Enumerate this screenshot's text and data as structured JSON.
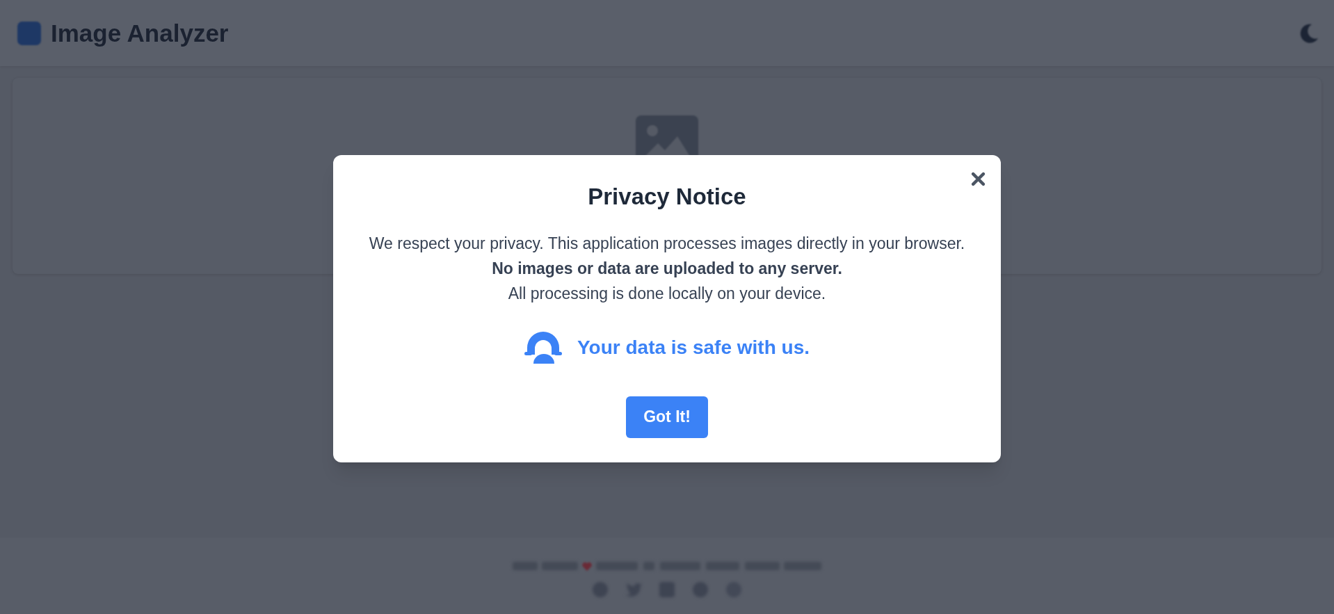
{
  "header": {
    "title": "Image Analyzer"
  },
  "modal": {
    "title": "Privacy Notice",
    "body": "We respect your privacy. This application processes images directly in your browser.\n**No images or data are uploaded to any server.**\nAll processing is done locally on your device.",
    "safe_note": "Your data is safe with us.",
    "button": "Got It!"
  }
}
